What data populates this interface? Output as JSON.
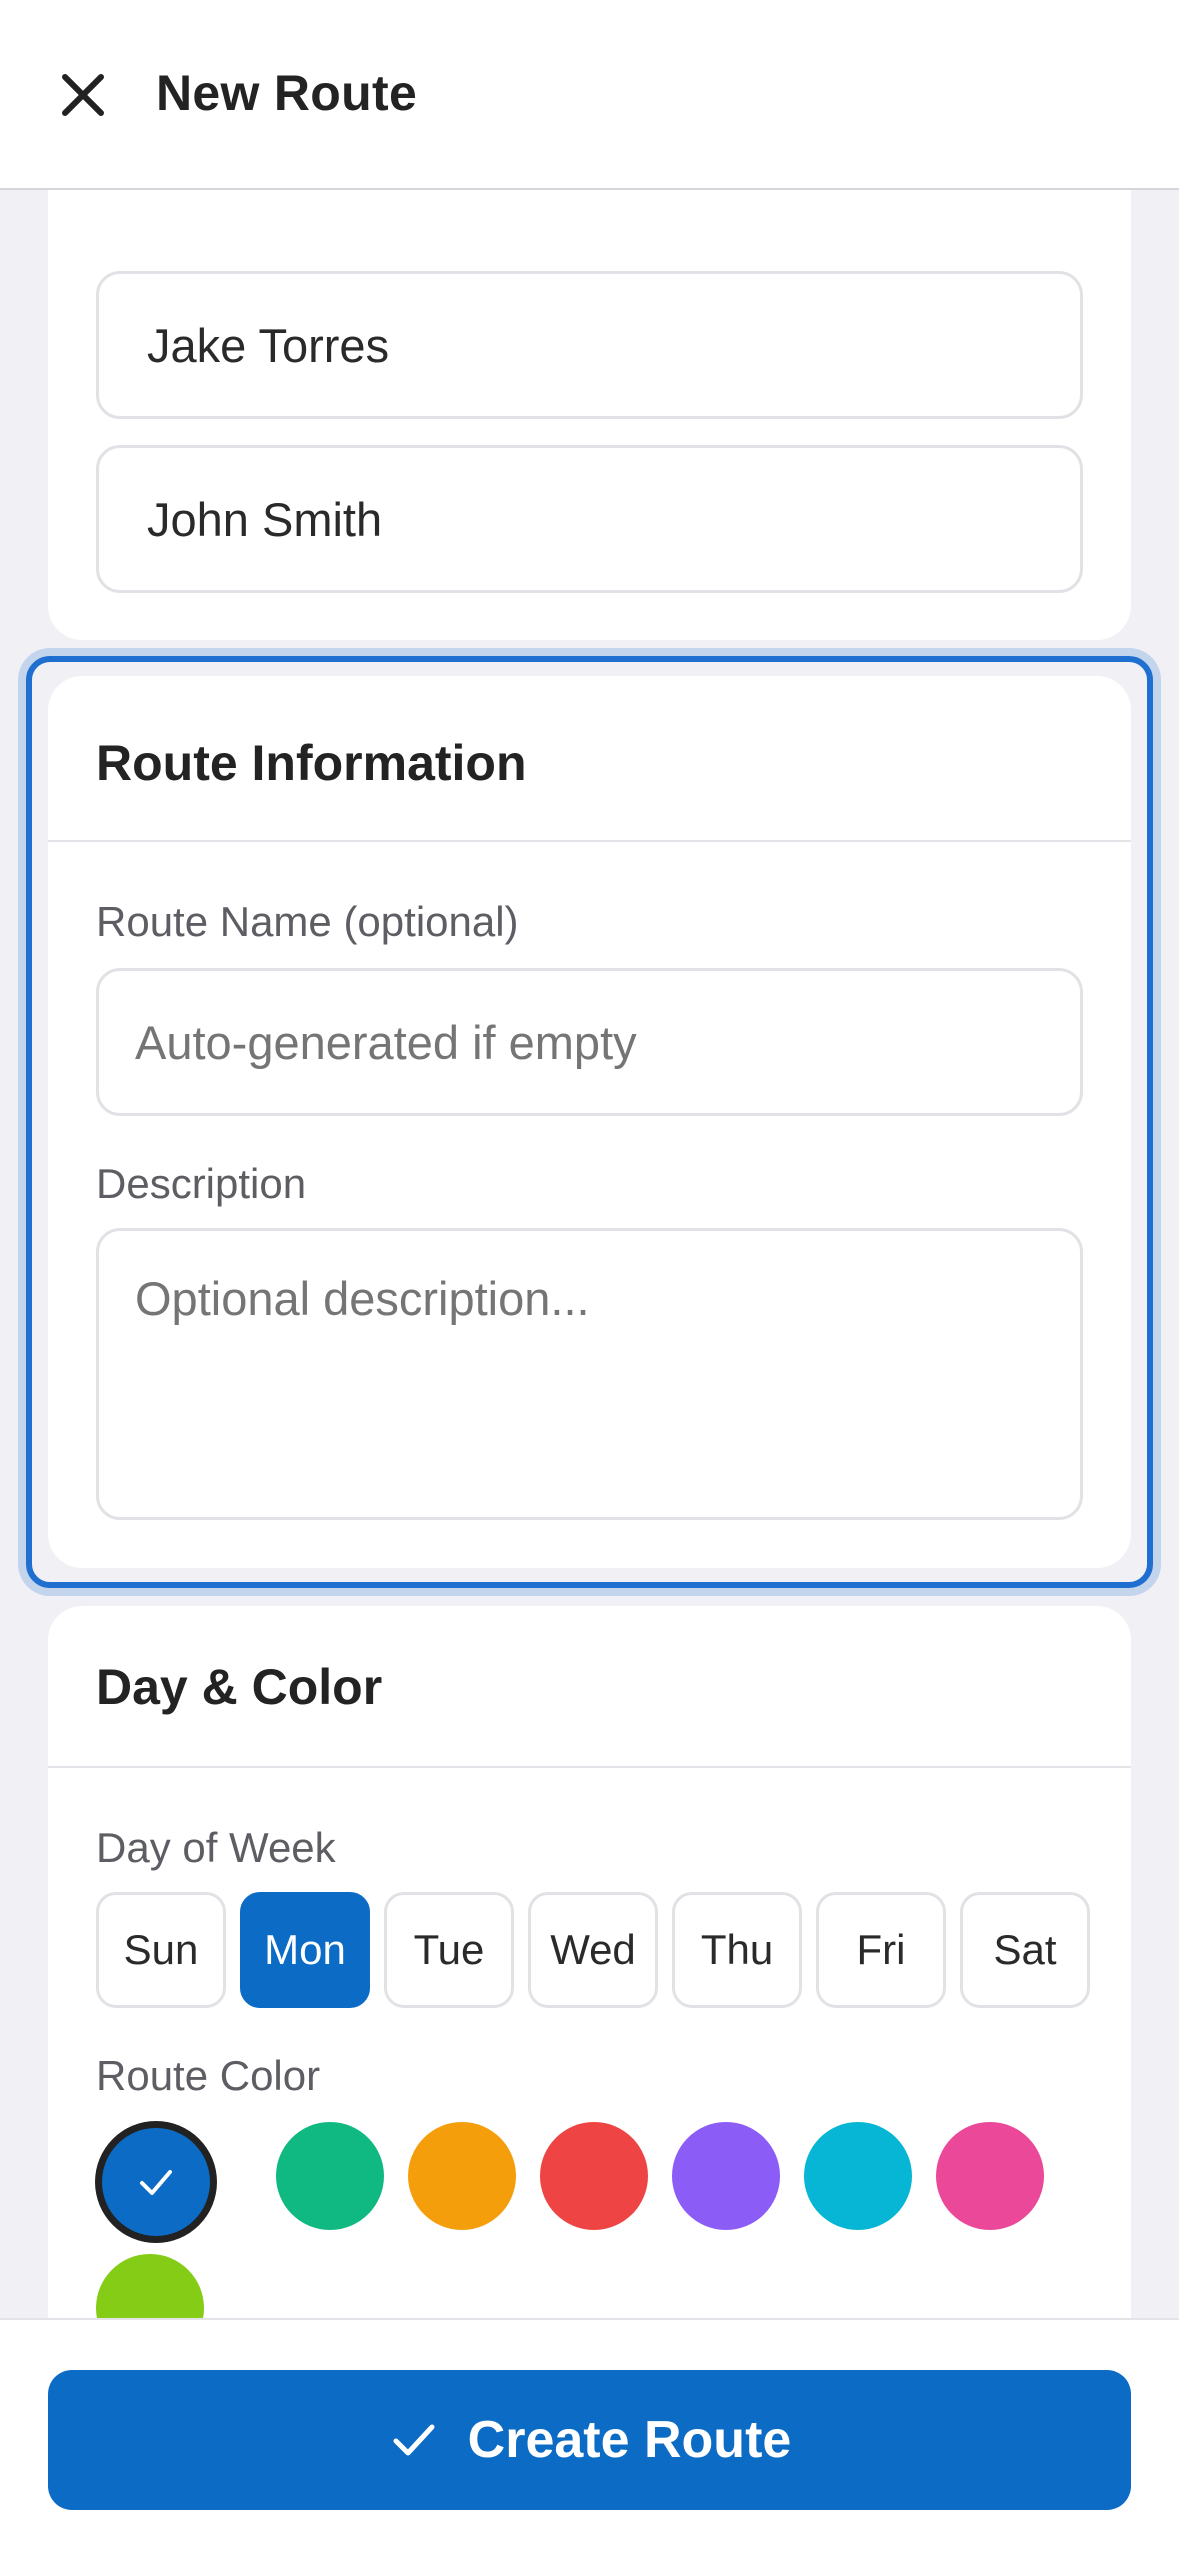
{
  "header": {
    "title": "New Route",
    "close_icon": "close-icon"
  },
  "drivers": {
    "items": [
      "",
      "Jake Torres",
      "John Smith"
    ]
  },
  "route_info": {
    "title": "Route Information",
    "name_label": "Route Name (optional)",
    "name_placeholder": "Auto-generated if empty",
    "name_value": "",
    "description_label": "Description",
    "description_placeholder": "Optional description...",
    "description_value": ""
  },
  "day_color": {
    "title": "Day & Color",
    "day_label": "Day of Week",
    "days": [
      "Sun",
      "Mon",
      "Tue",
      "Wed",
      "Thu",
      "Fri",
      "Sat"
    ],
    "selected_day": "Mon",
    "color_label": "Route Color",
    "colors": [
      "#0b6bc5",
      "#10b981",
      "#f59e0b",
      "#ef4444",
      "#8b5cf6",
      "#06b6d4",
      "#ec4899",
      "#84cc16"
    ],
    "selected_color": "#0b6bc5"
  },
  "footer": {
    "create_label": "Create Route",
    "create_icon": "check-icon"
  },
  "accent": "#0b6bc5"
}
